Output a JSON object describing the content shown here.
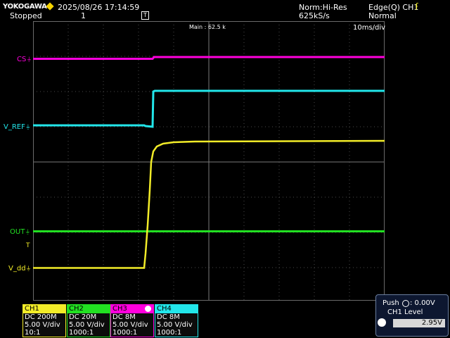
{
  "header": {
    "brand": "YOKOGAWA",
    "datetime": "2025/08/26 17:14:59",
    "state": "Stopped",
    "acq_count": "1",
    "trigger_marker": "T",
    "acq_mode": "Norm:Hi-Res",
    "sample_rate": "625kS/s",
    "trigger_type": "Edge(Q) CH1",
    "trigger_mode": "Normal"
  },
  "plot": {
    "main_record": "Main : 62.5 k",
    "timebase": "10ms/div",
    "trigger_level_marker": "T"
  },
  "channel_labels": {
    "cs": "CS",
    "v_ref": "V_REF",
    "out": "OUT",
    "v_dd": "V_dd"
  },
  "colors": {
    "ch1": "#f2ec28",
    "ch2": "#22e022",
    "ch3": "#ff00dd",
    "ch4": "#22e6ea",
    "grid": "#5a5a5a"
  },
  "channels": [
    {
      "name": "CH1",
      "coupling": "DC 200M",
      "scale": "5.00 V/div",
      "probe": "10:1",
      "color": "#f2ec28"
    },
    {
      "name": "CH2",
      "coupling": "DC 20M",
      "scale": "5.00 V/div",
      "probe": "1000:1",
      "color": "#22e022"
    },
    {
      "name": "CH3",
      "coupling": "DC 8M",
      "scale": "5.00 V/div",
      "probe": "1000:1",
      "color": "#ff00dd"
    },
    {
      "name": "CH4",
      "coupling": "DC 8M",
      "scale": "5.00 V/div",
      "probe": "1000:1",
      "color": "#22e6ea"
    }
  ],
  "push_panel": {
    "push_label": "Push",
    "push_value": ":  0.00V",
    "level_title": "CH1 Level",
    "level_value": "2.95V"
  }
}
